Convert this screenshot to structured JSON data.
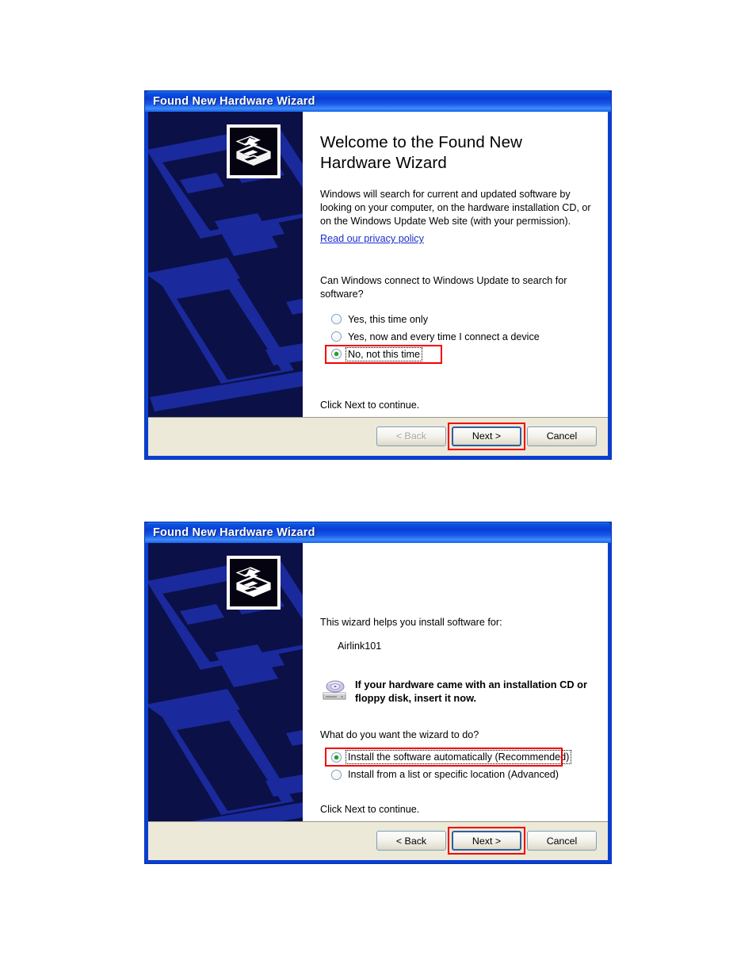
{
  "page": {
    "background": "#ffffff"
  },
  "colors": {
    "titlebar_blue": "#0a4fe0",
    "window_frame_blue": "#0a3fd4",
    "banner_navy": "#0b1047",
    "banner_graphic_blue": "#1a2a9c",
    "buttonbar_beige": "#ece9d8",
    "highlight_red": "#f40000",
    "link_blue": "#1a2ecf",
    "radio_dot_green": "#21a121"
  },
  "dialog1": {
    "titlebar": {
      "title": "Found New Hardware Wizard",
      "icon": "none"
    },
    "banner": {
      "hardware_icon": "hardware-device-icon",
      "graphic": "isometric-computer-outline"
    },
    "heading": "Welcome to the Found New Hardware Wizard",
    "paragraph": "Windows will search for current and updated software by looking on your computer, on the hardware installation CD, or on the Windows Update Web site (with your permission).",
    "privacy_link": "Read our privacy policy",
    "question": "Can Windows connect to Windows Update to search for software?",
    "options": [
      {
        "label": "Yes, this time only",
        "accel": "Y",
        "checked": false,
        "focused": false,
        "highlighted": false
      },
      {
        "label": "Yes, now and every time I connect a device",
        "accel": "e",
        "checked": false,
        "focused": false,
        "highlighted": false
      },
      {
        "label": "No, not this time",
        "accel": "t",
        "checked": true,
        "focused": true,
        "highlighted": true
      }
    ],
    "closing": "Click Next to continue.",
    "buttons": [
      {
        "label": "< Back",
        "accel": "B",
        "disabled": true,
        "default": false,
        "highlighted": false
      },
      {
        "label": "Next >",
        "accel": "N",
        "disabled": false,
        "default": true,
        "highlighted": true
      },
      {
        "label": "Cancel",
        "accel": "",
        "disabled": false,
        "default": false,
        "highlighted": false
      }
    ]
  },
  "dialog2": {
    "titlebar": {
      "title": "Found New Hardware Wizard",
      "icon": "none"
    },
    "banner": {
      "hardware_icon": "hardware-device-icon",
      "graphic": "isometric-computer-outline"
    },
    "intro": "This wizard helps you install software for:",
    "device_name": "Airlink101",
    "cd_note": "If your hardware came with an installation CD or floppy disk, insert it now.",
    "cd_note_icon": "cd-drive-icon",
    "question": "What do you want the wizard to do?",
    "options": [
      {
        "label": "Install the software automatically (Recommended)",
        "accel": "I",
        "checked": true,
        "focused": true,
        "highlighted": true
      },
      {
        "label": "Install from a list or specific location (Advanced)",
        "accel": "s",
        "checked": false,
        "focused": false,
        "highlighted": false
      }
    ],
    "closing": "Click Next to continue.",
    "buttons": [
      {
        "label": "< Back",
        "accel": "B",
        "disabled": false,
        "default": false,
        "highlighted": false
      },
      {
        "label": "Next >",
        "accel": "N",
        "disabled": false,
        "default": true,
        "highlighted": true
      },
      {
        "label": "Cancel",
        "accel": "",
        "disabled": false,
        "default": false,
        "highlighted": false
      }
    ]
  }
}
